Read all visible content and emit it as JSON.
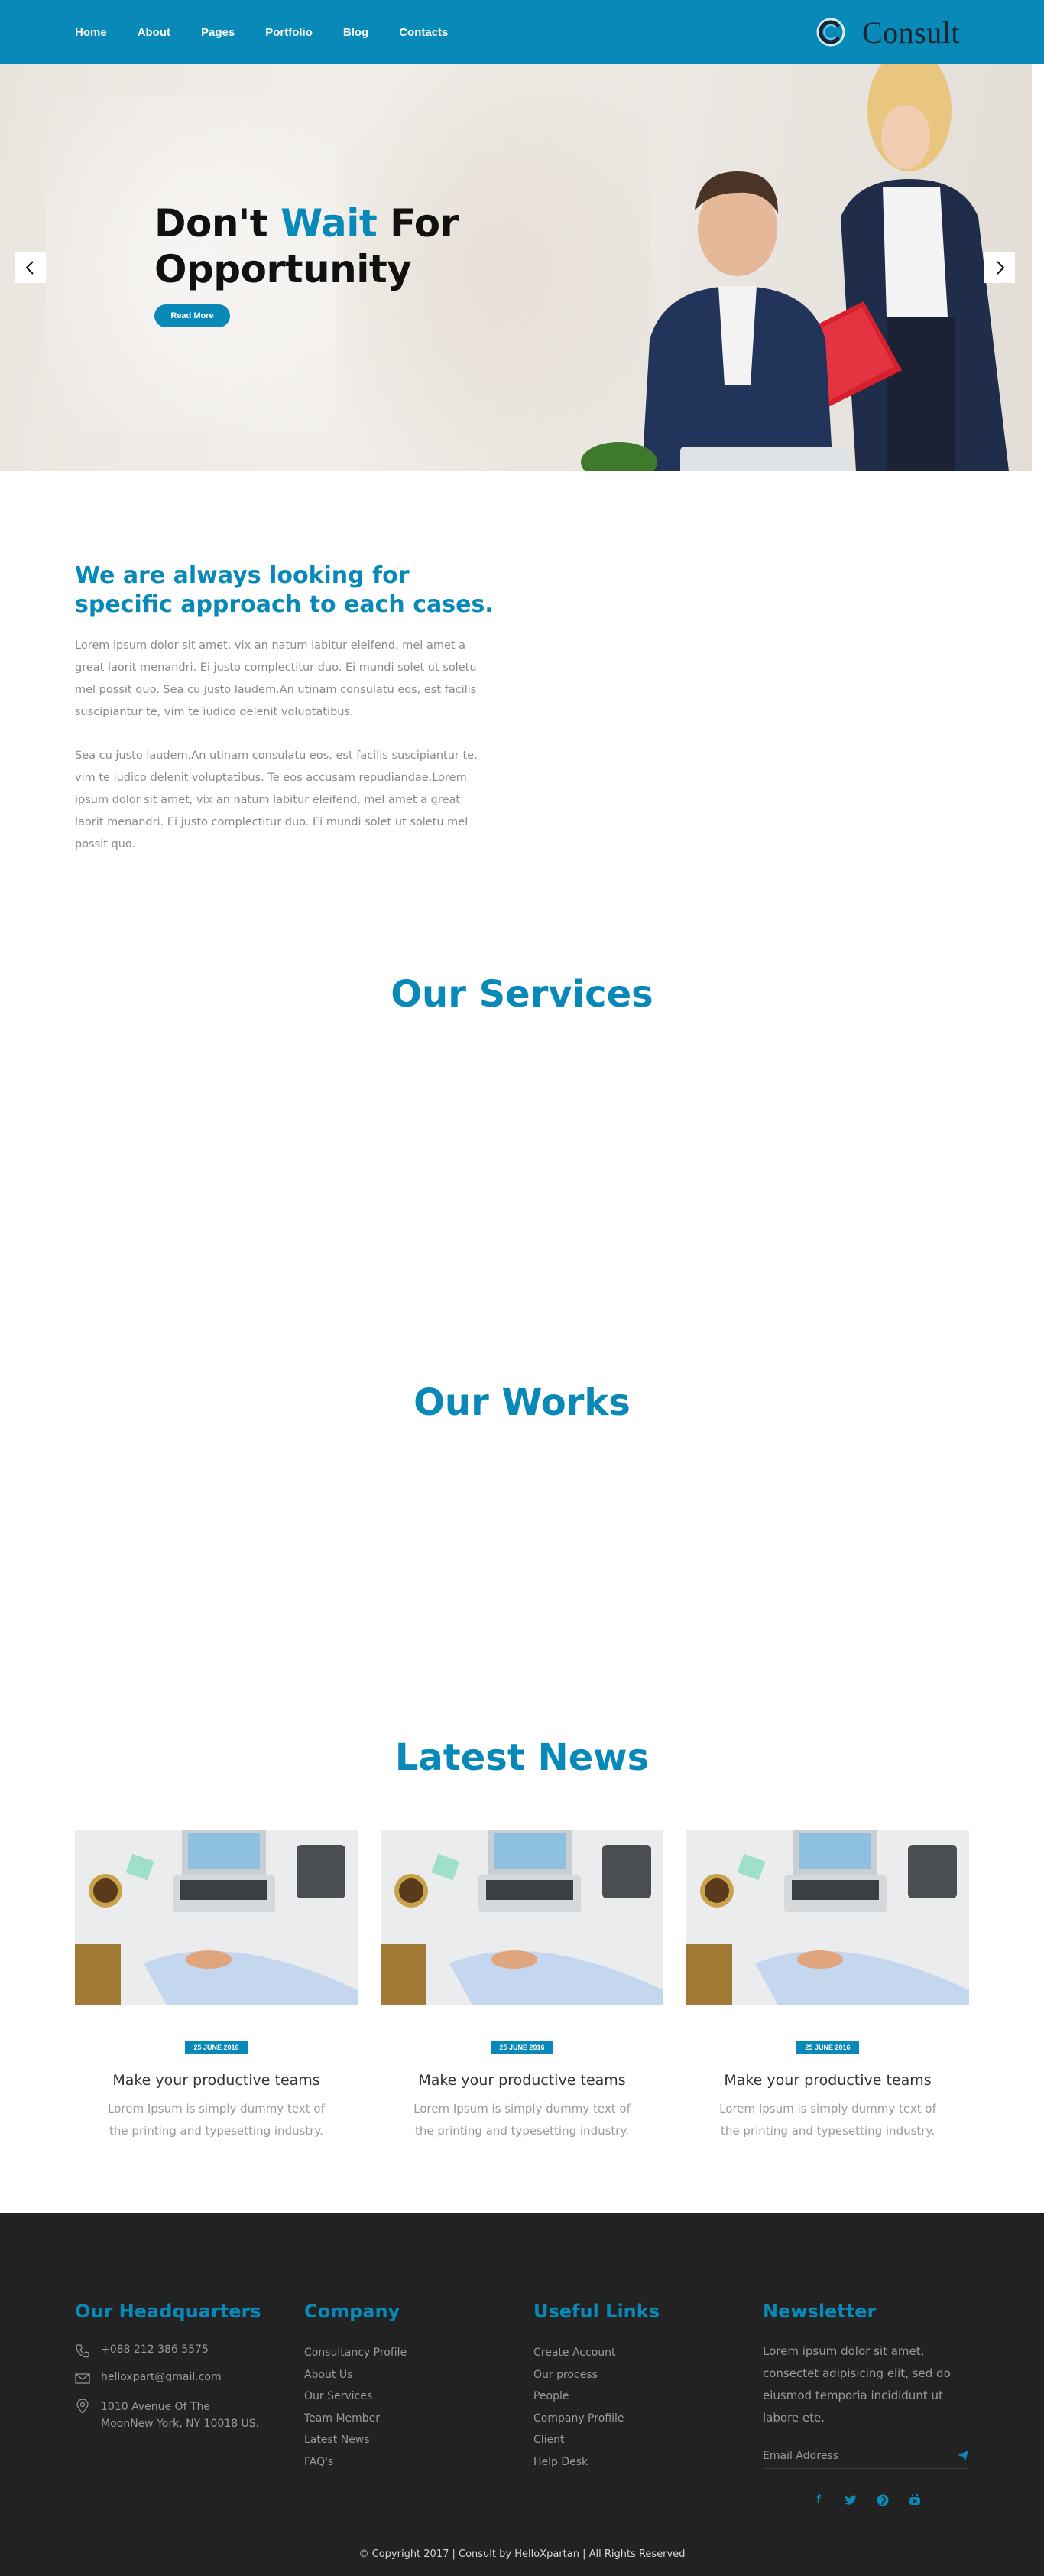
{
  "nav": {
    "items": [
      "Home",
      "About",
      "Pages",
      "Portfolio",
      "Blog",
      "Contacts"
    ],
    "logo_text": "Consult",
    "accent_color": "#0889b8"
  },
  "hero": {
    "title_part1": "Don't ",
    "title_accent": "Wait",
    "title_part2": " For",
    "title_line2": "Opportunity",
    "button_label": "Read More",
    "prev_icon": "chevron-left-icon",
    "next_icon": "chevron-right-icon"
  },
  "about": {
    "title": "We are always looking for specific approach to each cases.",
    "paragraph1": "Lorem ipsum dolor sit amet, vix an natum labitur eleifend, mel amet a great laorit menandri. Ei justo complectitur duo. Ei mundi solet ut soletu mel possit quo. Sea cu justo laudem.An utinam consulatu eos, est facilis suscipiantur te, vim te iudico delenit voluptatibus.",
    "paragraph2": "Sea cu justo laudem.An utinam consulatu eos, est facilis suscipiantur te, vim te iudico delenit voluptatibus. Te eos accusam repudiandae.Lorem ipsum dolor sit amet, vix an natum labitur eleifend, mel amet a great laorit menandri. Ei justo complectitur duo. Ei mundi solet ut soletu mel possit quo."
  },
  "sections": {
    "services": "Our Services",
    "works": "Our Works",
    "news": "Latest News"
  },
  "news": [
    {
      "date": "25 JUNE 2016",
      "title": "Make your productive teams",
      "text": "Lorem Ipsum is simply dummy text of the printing and typesetting industry."
    },
    {
      "date": "25 JUNE 2016",
      "title": "Make your productive teams",
      "text": "Lorem Ipsum is simply dummy text of the printing and typesetting industry."
    },
    {
      "date": "25 JUNE 2016",
      "title": "Make your productive teams",
      "text": "Lorem Ipsum is simply dummy text of the printing and typesetting industry."
    }
  ],
  "footer": {
    "hq": {
      "title": "Our Headquarters",
      "phone": "+088 212 386 5575",
      "email": "helloxpart@gmail.com",
      "address": "1010 Avenue Of The MoonNew York, NY 10018 US."
    },
    "company": {
      "title": "Company",
      "links": [
        "Consultancy Profile",
        "About Us",
        "Our Services",
        "Team Member",
        "Latest News",
        "FAQ's"
      ]
    },
    "useful": {
      "title": "Useful Links",
      "links": [
        "Create Account",
        "Our process",
        "People",
        "Company Profiile",
        "Client",
        "Help Desk"
      ]
    },
    "newsletter": {
      "title": "Newsletter",
      "text": "Lorem ipsum dolor sit amet, consectet adipisicing elit, sed do eiusmod temporia incididunt ut labore ete.",
      "placeholder": "Email Address",
      "send_icon": "send-icon",
      "social_icons": [
        "facebook-icon",
        "twitter-icon",
        "pinterest-icon",
        "youtube-icon"
      ]
    },
    "copyright": "© Copyright 2017 | Consult by HelloXpartan | All Rights Reserved"
  }
}
